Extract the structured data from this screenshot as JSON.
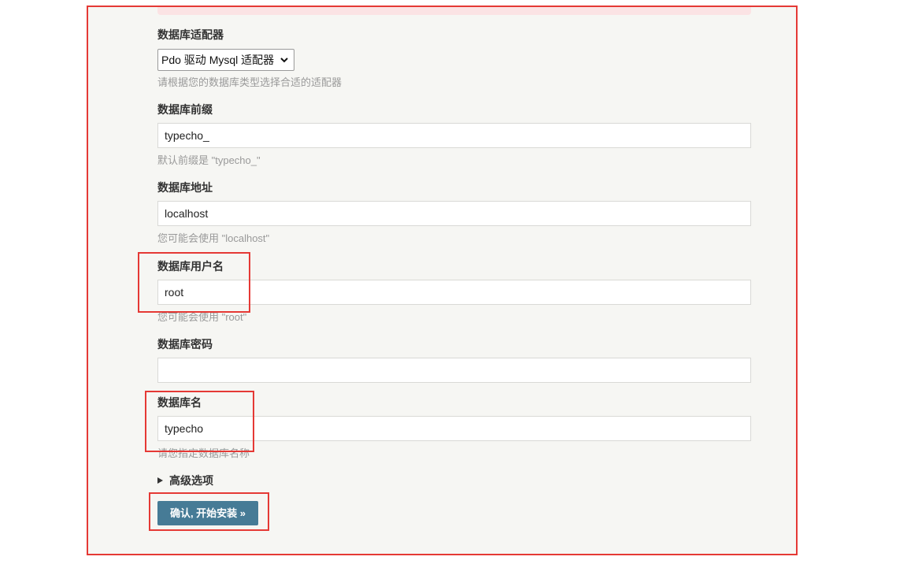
{
  "form": {
    "adapter": {
      "label": "数据库适配器",
      "selected": "Pdo 驱动 Mysql 适配器",
      "hint": "请根据您的数据库类型选择合适的适配器"
    },
    "prefix": {
      "label": "数据库前缀",
      "value": "typecho_",
      "hint": "默认前缀是 \"typecho_\""
    },
    "host": {
      "label": "数据库地址",
      "value": "localhost",
      "hint": "您可能会使用 \"localhost\""
    },
    "user": {
      "label": "数据库用户名",
      "value": "root",
      "hint": "您可能会使用 \"root\""
    },
    "password": {
      "label": "数据库密码",
      "value": ""
    },
    "dbname": {
      "label": "数据库名",
      "value": "typecho",
      "hint": "请您指定数据库名称"
    },
    "advanced_label": "高级选项",
    "submit_label": "确认, 开始安装 »"
  },
  "annotation_color": "#e53935",
  "button_color": "#467b96"
}
